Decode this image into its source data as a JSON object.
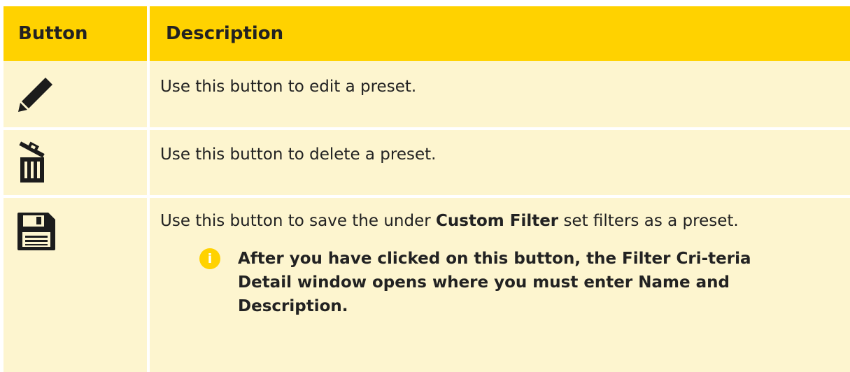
{
  "table": {
    "headers": {
      "button": "Button",
      "description": "Description"
    },
    "rows": [
      {
        "icon": "pencil-edit-icon",
        "description": "Use this button to edit a preset."
      },
      {
        "icon": "trash-delete-icon",
        "description": "Use this button to delete a preset."
      },
      {
        "icon": "floppy-save-icon",
        "description_before": "Use this button to save the under ",
        "description_bold": "Custom Filter",
        "description_after": " set filters as a preset.",
        "note": {
          "icon": "info-icon",
          "icon_glyph": "i",
          "text": "After you have clicked on this button, the Filter Cri-teria Detail window opens where you must enter Name and Description."
        }
      }
    ]
  },
  "colors": {
    "header_bg": "#ffd200",
    "row_bg": "#fdf5cf",
    "text": "#222222",
    "info_accent": "#ffd200"
  }
}
